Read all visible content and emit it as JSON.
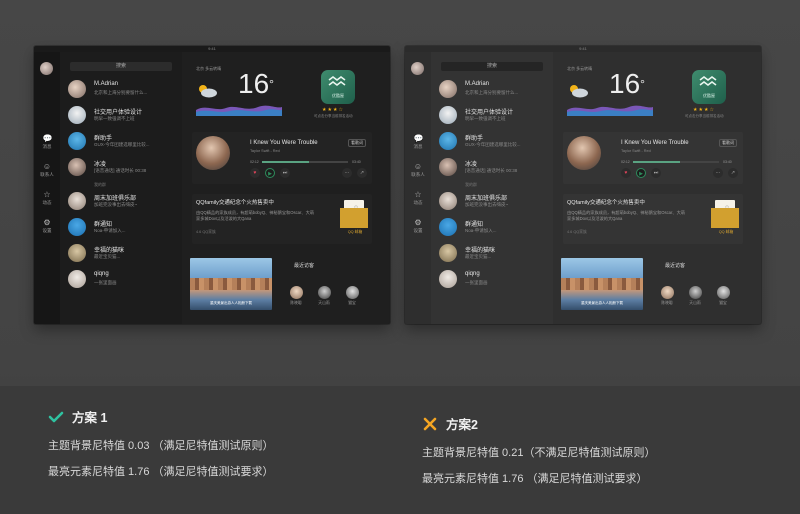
{
  "status_bar": {
    "time": "9:41"
  },
  "screens": {
    "search_placeholder": "搜索",
    "nav": [
      "消息",
      "联系人",
      "动态",
      "设置"
    ],
    "contacts": [
      {
        "name": "M.Adrian",
        "message": "北京和上海分别要留什么..."
      },
      {
        "name": "社交用户体验设计",
        "message": "明早一致强调不上班"
      },
      {
        "name": "群助手",
        "message": "GUX-今年团建选哪里比较..."
      },
      {
        "name": "冰凌",
        "message": "[语音通话] 通话时长 00:38"
      },
      {
        "name": "周末加班俱乐部",
        "message": "加班完没事出去嗨皮~",
        "subtitle": "我的群"
      },
      {
        "name": "群通知",
        "message": "Noa-申请加入..."
      },
      {
        "name": "幸福的猫咪",
        "message": "最近宝贝猫..."
      },
      {
        "name": "qiqng",
        "message": "一张里面画"
      }
    ],
    "weather": {
      "location": "北京  多云转晴",
      "temperature": "16",
      "unit": "°"
    },
    "app_card": {
      "name": "优酷屋",
      "stars": "★★★☆",
      "desc": "可点击分享当前排名活动"
    },
    "music": {
      "song": "I Knew You Were Trouble",
      "lyric": "Taylor Swift - Red",
      "time_start": "02:12",
      "time_end": "03:40",
      "lyrics_button": "看歌词",
      "progress": 0.55
    },
    "qzone": {
      "title": "QQfamily交通纪念个火热售卖中",
      "desc": "由QQ精品的家族成员，有超萌bobyQ、神秘鹅宝和Oscar、大萌家多城Dov以及活泼的大Qana",
      "footer": "4.6 QQ家族",
      "envelope_label": "QQ 邮箱"
    },
    "recent_visitors": {
      "title": "最近访客",
      "names": [
        "陈晓聪",
        "天山雨",
        "猫宝"
      ]
    },
    "photo_caption": "重庆美景出游人人相册下载"
  },
  "schemes": [
    {
      "mark": "check",
      "title": "方案 1",
      "line1": "主题背景尼特值   0.03  （满足尼特值测试原则）",
      "line2": "最亮元素尼特值   1.76  （满足尼特值测试要求）",
      "mark_color": "#2fc2a0"
    },
    {
      "mark": "cross",
      "title": "方案2",
      "line1": "主题背景尼特值   0.21（不满足尼特值测试原则）",
      "line2": "最亮元素尼特值   1.76  （满足尼特值测试要求）",
      "mark_color": "#f5a623"
    }
  ]
}
